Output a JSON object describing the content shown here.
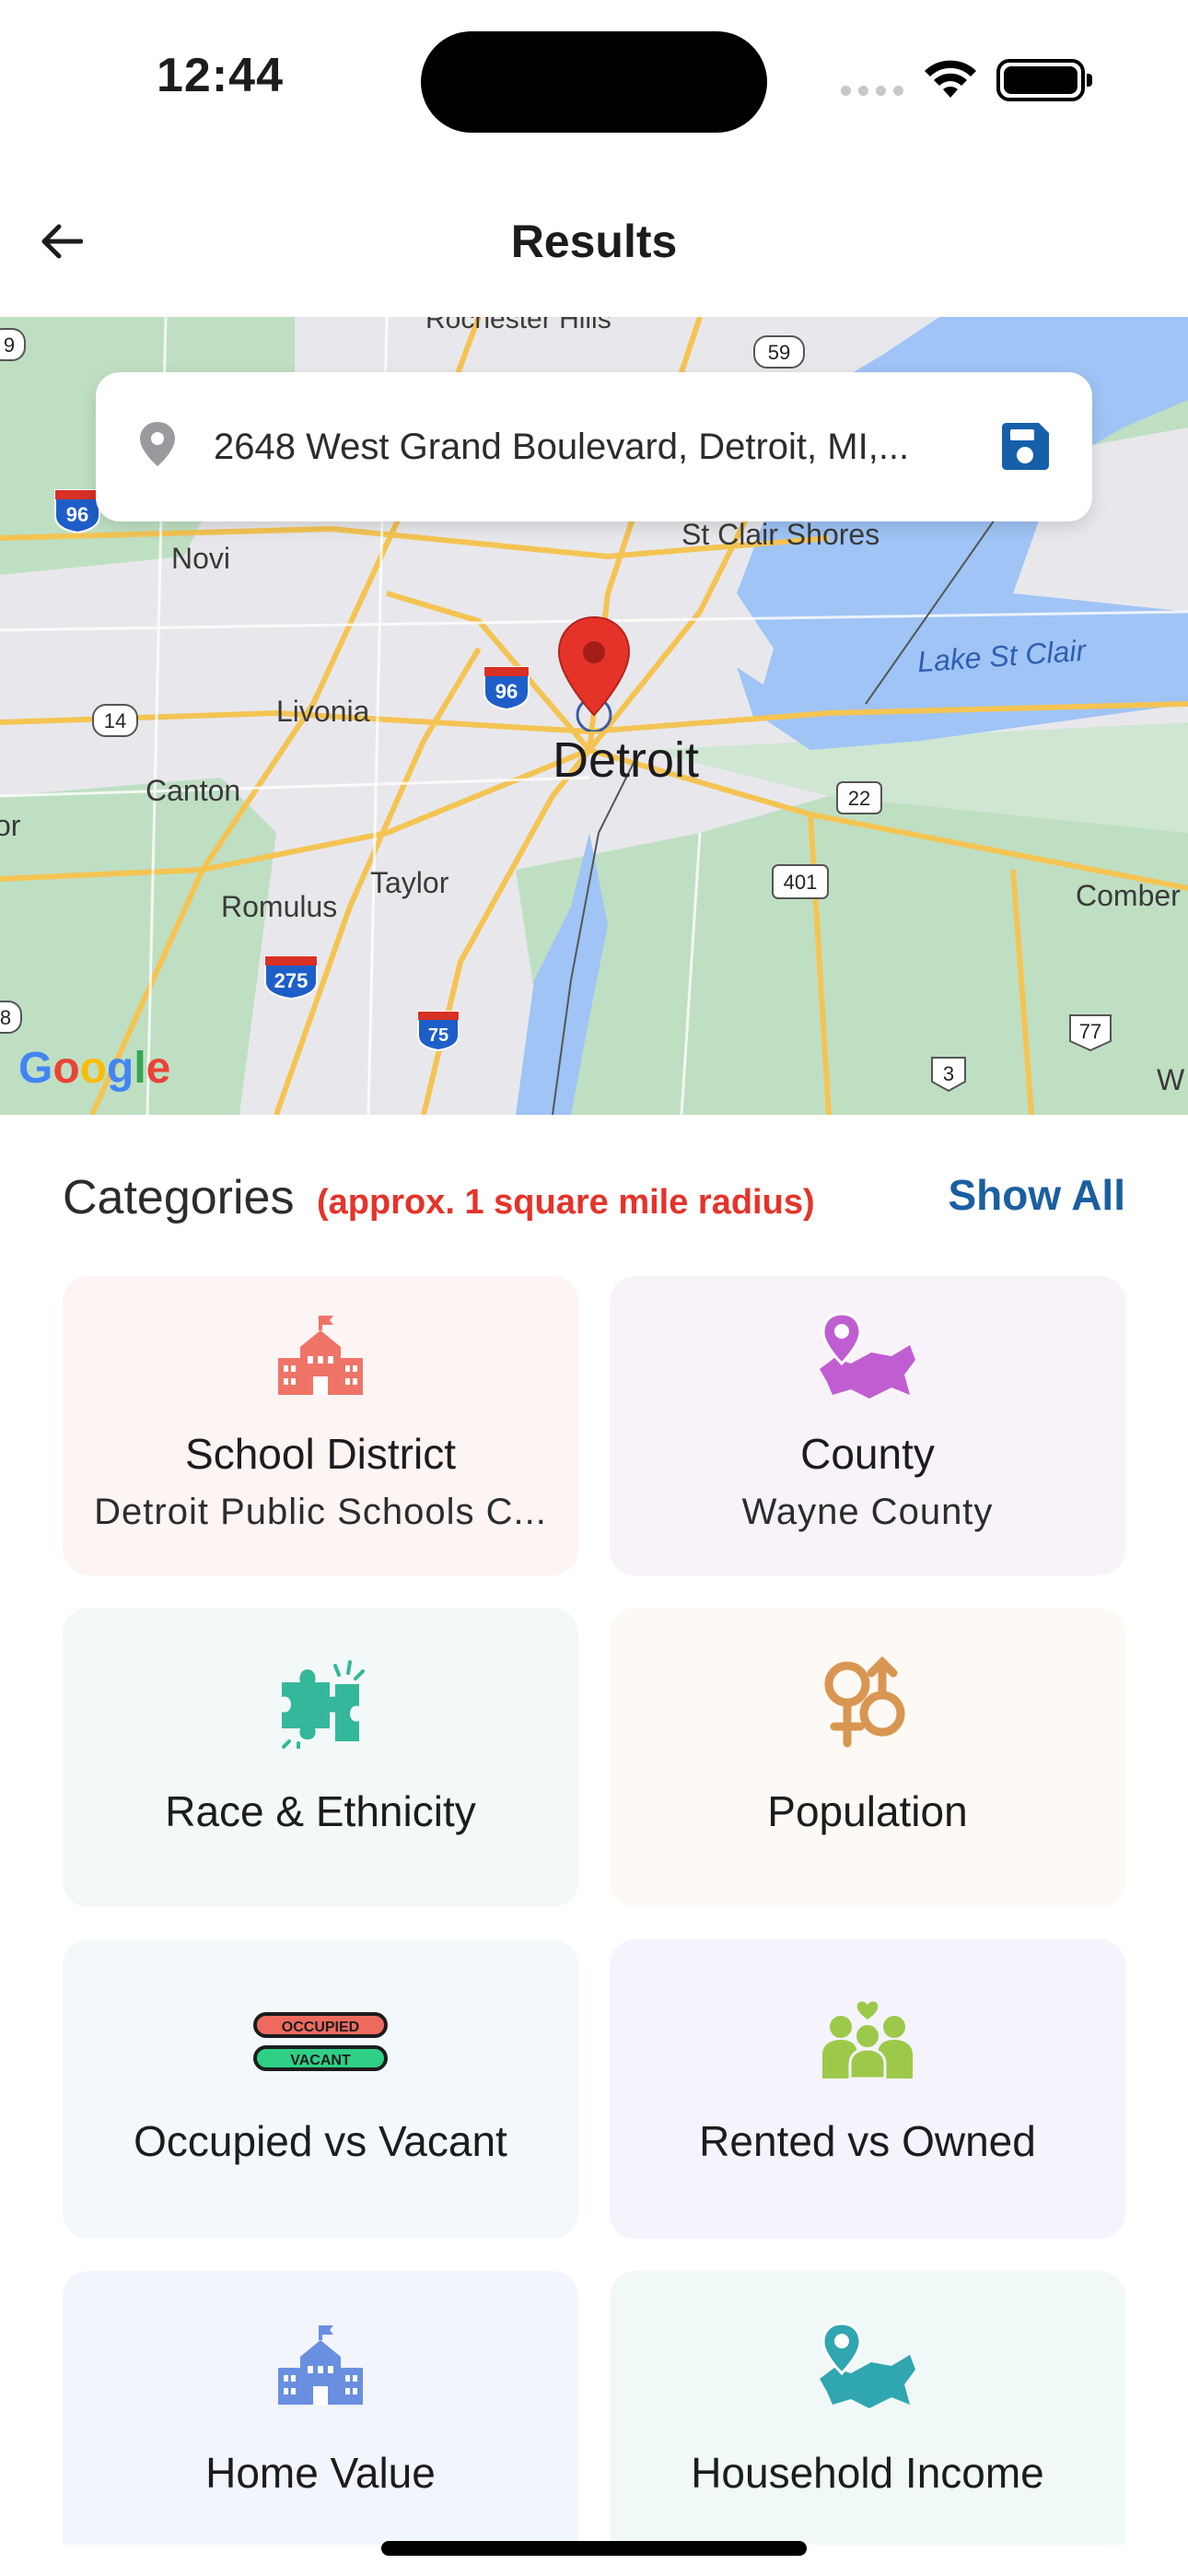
{
  "status_bar": {
    "time": "12:44"
  },
  "nav": {
    "title": "Results"
  },
  "search": {
    "address": "2648 West Grand Boulevard, Detroit, MI,..."
  },
  "map": {
    "labels": {
      "rochester": "Rochester Hills",
      "st_clair_shores": "St Clair Shores",
      "lake_st_clair": "Lake St Clair",
      "novi": "Novi",
      "livonia": "Livonia",
      "detroit": "Detroit",
      "canton": "Canton",
      "taylor": "Taylor",
      "romulus": "Romulus",
      "comber": "Comber",
      "or": "or",
      "w": "W"
    },
    "shields": {
      "s59": "59",
      "s96a": "96",
      "s96b": "96",
      "s14": "14",
      "s22": "22",
      "s401": "401",
      "s275": "275",
      "s75": "75",
      "s77": "77",
      "s3": "3",
      "s9": "9",
      "s8": "8"
    },
    "google": "Google"
  },
  "categories": {
    "title": "Categories",
    "note": "(approx. 1 square mile radius)",
    "show_all": "Show All",
    "items": [
      {
        "title": "School District",
        "subtitle": "Detroit Public Schools C...",
        "icon": "school-icon",
        "bg": "#fdf5f3",
        "color": "#ef7468"
      },
      {
        "title": "County",
        "subtitle": "Wayne County",
        "icon": "county-map-icon",
        "bg": "#f8f3f8",
        "color": "#c05ed1"
      },
      {
        "title": "Race & Ethnicity",
        "subtitle": "",
        "icon": "puzzle-icon",
        "bg": "#f3f9f8",
        "color": "#34b79a"
      },
      {
        "title": "Population",
        "subtitle": "",
        "icon": "gender-icon",
        "bg": "#fdf9f4",
        "color": "#d99652"
      },
      {
        "title": "Occupied vs Vacant",
        "subtitle": "",
        "icon": "occupied-vacant-icon",
        "bg": "#f3f9fb",
        "color": "#2e3a40"
      },
      {
        "title": "Rented vs Owned",
        "subtitle": "",
        "icon": "people-icon",
        "bg": "#f5f3fb",
        "color": "#9cc94a"
      },
      {
        "title": "Home Value",
        "subtitle": "",
        "icon": "home-value-icon",
        "bg": "#f2f5fc",
        "color": "#6a8fe0"
      },
      {
        "title": "Household Income",
        "subtitle": "",
        "icon": "income-map-icon",
        "bg": "#f1f9f8",
        "color": "#2fa6b0"
      }
    ],
    "occupied_label": "OCCUPIED",
    "vacant_label": "VACANT"
  }
}
